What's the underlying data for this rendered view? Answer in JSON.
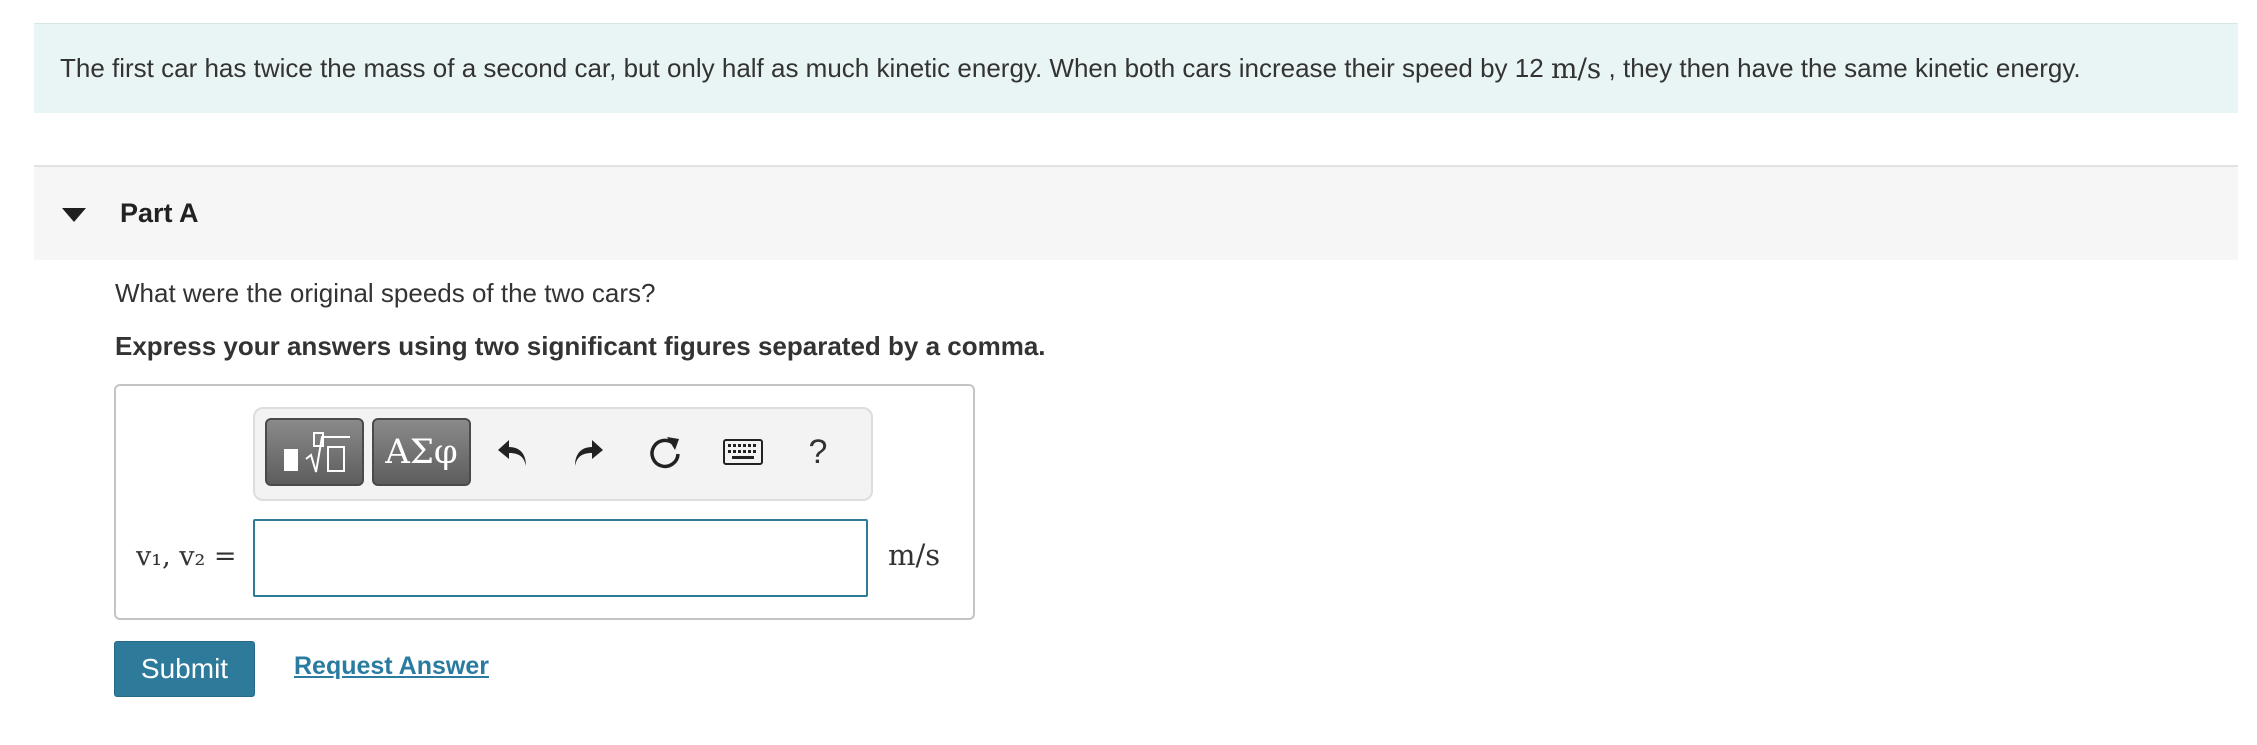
{
  "intro": {
    "text_before": "The first car has twice the mass of a second car, but only half as much kinetic energy. When both cars increase their speed by 12",
    "speed_unit": "m/s",
    "text_after": ", they then have the same kinetic energy."
  },
  "part": {
    "title": "Part A",
    "question": "What were the original speeds of the two cars?",
    "instruction": "Express your answers using two significant figures separated by a comma."
  },
  "toolbar": {
    "symbols_label": "ΑΣφ",
    "help_label": "?"
  },
  "answer": {
    "variable_label": "v₁, v₂ =",
    "value": "",
    "unit": "m/s"
  },
  "actions": {
    "submit_label": "Submit",
    "request_answer_label": "Request Answer"
  },
  "colors": {
    "intro_bg": "#e9f5f5",
    "part_header_bg": "#f6f6f6",
    "accent": "#2e7a9b",
    "link": "#2a7ba0"
  },
  "icons": [
    "caret-down-icon",
    "templates-icon",
    "undo-icon",
    "redo-icon",
    "reset-icon",
    "keyboard-icon",
    "help-icon"
  ]
}
